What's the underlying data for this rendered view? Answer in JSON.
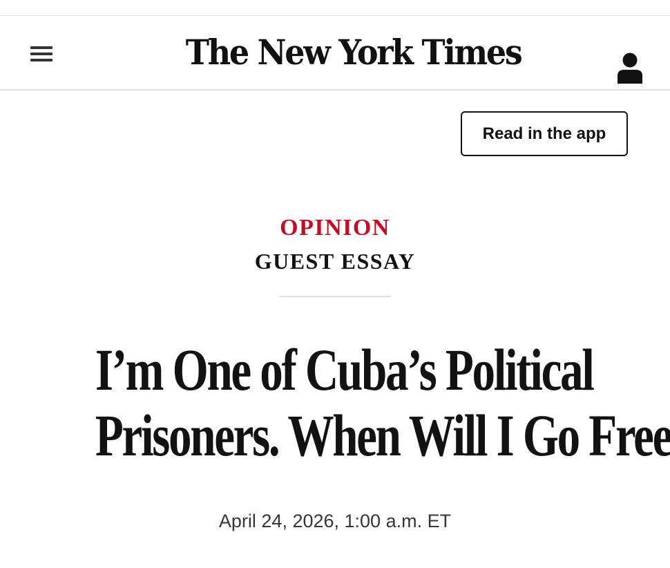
{
  "header": {
    "logo_text": "The New York Times",
    "menu_icon": "hamburger-menu-icon",
    "account_icon": "person-icon"
  },
  "cta": {
    "read_in_app_label": "Read in the app"
  },
  "article": {
    "section_label": "OPINION",
    "subsection_label": "GUEST ESSAY",
    "headline_line_1": "I’m One of Cuba’s Political",
    "headline_line_2": "Prisoners. When Will I Go Free?",
    "date": "April 24, 2026, 1:00 a.m. ET"
  },
  "colors": {
    "opinion_accent": "#c20d25",
    "text": "#121212",
    "divider": "#e2e2e2"
  }
}
